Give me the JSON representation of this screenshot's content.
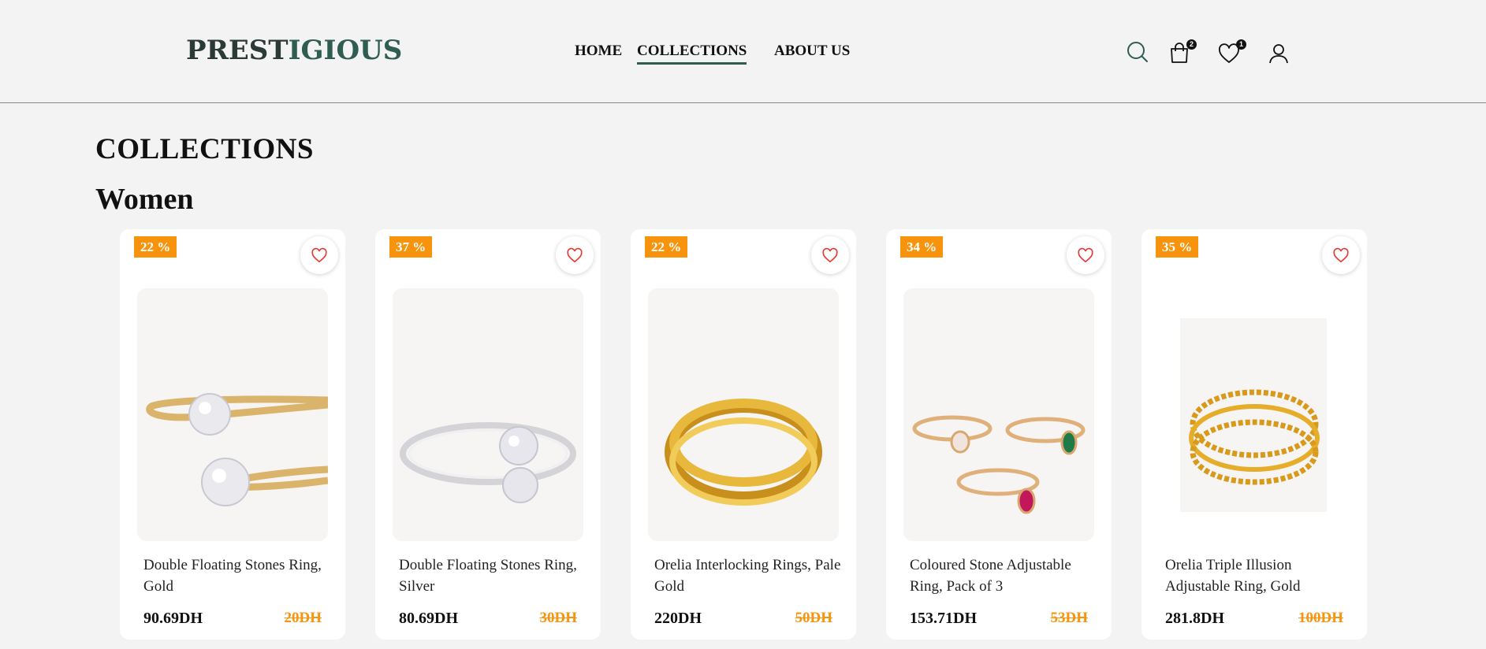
{
  "header": {
    "logo_part1": "PREST",
    "logo_part2": "IGIOUS",
    "nav": {
      "home": "HOME",
      "collections": "COLLECTIONS",
      "about": "ABOUT US"
    },
    "cart_count": "2",
    "wishlist_count": "1"
  },
  "page": {
    "title": "COLLECTIONS",
    "section": "Women"
  },
  "colors": {
    "accent_green": "#2f5d52",
    "discount_orange": "#f7930c",
    "heart_red": "#e53935"
  },
  "products": [
    {
      "discount": "22 %",
      "name": "Double Floating Stones Ring, Gold",
      "price": "90.69DH",
      "old_price": "20DH",
      "image_icon": "gold-double-stone-ring"
    },
    {
      "discount": "37 %",
      "name": "Double Floating Stones Ring, Silver",
      "price": "80.69DH",
      "old_price": "30DH",
      "image_icon": "silver-double-stone-ring"
    },
    {
      "discount": "22 %",
      "name": "Orelia Interlocking Rings, Pale Gold",
      "price": "220DH",
      "old_price": "50DH",
      "image_icon": "interlocking-gold-rings"
    },
    {
      "discount": "34 %",
      "name": "Coloured Stone Adjustable Ring, Pack of 3",
      "price": "153.71DH",
      "old_price": "53DH",
      "image_icon": "three-stone-rings"
    },
    {
      "discount": "35 %",
      "name": "Orelia Triple Illusion Adjustable Ring, Gold",
      "price": "281.8DH",
      "old_price": "100DH",
      "image_icon": "triple-gold-ring"
    }
  ]
}
